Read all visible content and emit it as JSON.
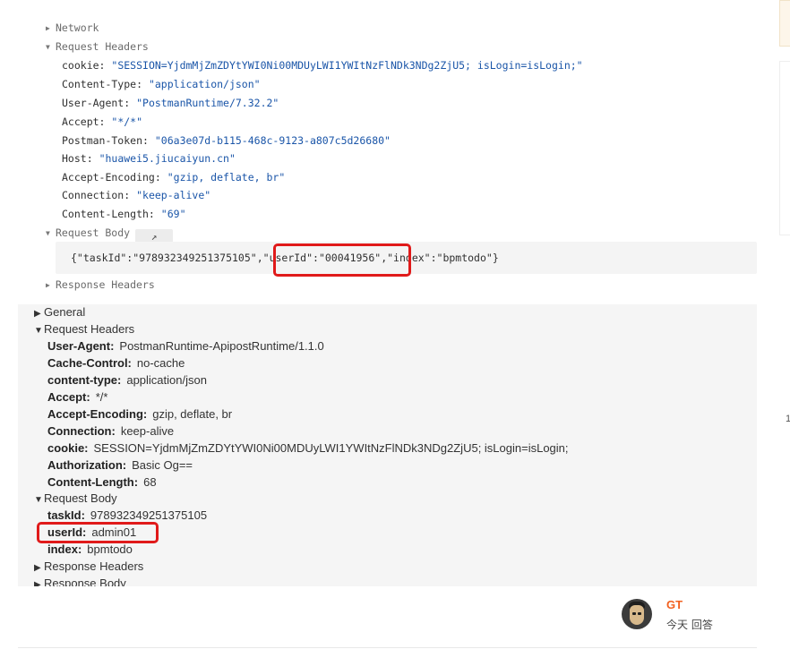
{
  "console": {
    "network_label": "Network",
    "request_headers_label": "Request Headers",
    "headers": [
      {
        "key": "cookie:",
        "value": "\"SESSION=YjdmMjZmZDYtYWI0Ni00MDUyLWI1YWItNzFlNDk3NDg2ZjU5; isLogin=isLogin;\""
      },
      {
        "key": "Content-Type:",
        "value": "\"application/json\""
      },
      {
        "key": "User-Agent:",
        "value": "\"PostmanRuntime/7.32.2\""
      },
      {
        "key": "Accept:",
        "value": "\"*/*\""
      },
      {
        "key": "Postman-Token:",
        "value": "\"06a3e07d-b115-468c-9123-a807c5d26680\""
      },
      {
        "key": "Host:",
        "value": "\"huawei5.jiucaiyun.cn\""
      },
      {
        "key": "Accept-Encoding:",
        "value": "\"gzip, deflate, br\""
      },
      {
        "key": "Connection:",
        "value": "\"keep-alive\""
      },
      {
        "key": "Content-Length:",
        "value": "\"69\""
      }
    ],
    "request_body_label": "Request Body",
    "open_icon": "↗",
    "body_part1": "{\"taskId\":\"978932349251375105\"",
    "body_part2": ",\"userId\":\"00041956\"",
    "body_part3": ",\"index\":\"bpmtodo\"}",
    "response_headers_label": "Response Headers"
  },
  "devtools": {
    "general_label": "General",
    "request_headers_label": "Request Headers",
    "headers": [
      {
        "key": "User-Agent:",
        "value": "PostmanRuntime-ApipostRuntime/1.1.0"
      },
      {
        "key": "Cache-Control:",
        "value": "no-cache"
      },
      {
        "key": "content-type:",
        "value": "application/json"
      },
      {
        "key": "Accept:",
        "value": "*/*"
      },
      {
        "key": "Accept-Encoding:",
        "value": "gzip, deflate, br"
      },
      {
        "key": "Connection:",
        "value": "keep-alive"
      },
      {
        "key": "cookie:",
        "value": "SESSION=YjdmMjZmZDYtYWI0Ni00MDUyLWI1YWItNzFlNDk3NDg2ZjU5; isLogin=isLogin;"
      },
      {
        "key": "Authorization:",
        "value": "Basic Og=="
      },
      {
        "key": "Content-Length:",
        "value": "68"
      }
    ],
    "request_body_label": "Request Body",
    "body": [
      {
        "key": "taskId:",
        "value": "978932349251375105"
      },
      {
        "key": "userId:",
        "value": "admin01"
      },
      {
        "key": "index:",
        "value": "bpmtodo"
      }
    ],
    "response_headers_label": "Response Headers",
    "response_body_label": "Response Body"
  },
  "answer": {
    "author": "GT",
    "meta": "今天 回答"
  },
  "side": {
    "number": "1"
  },
  "colors": {
    "highlight": "#e01a1a",
    "author": "#f2611f",
    "value_blue": "#1a55a8"
  }
}
